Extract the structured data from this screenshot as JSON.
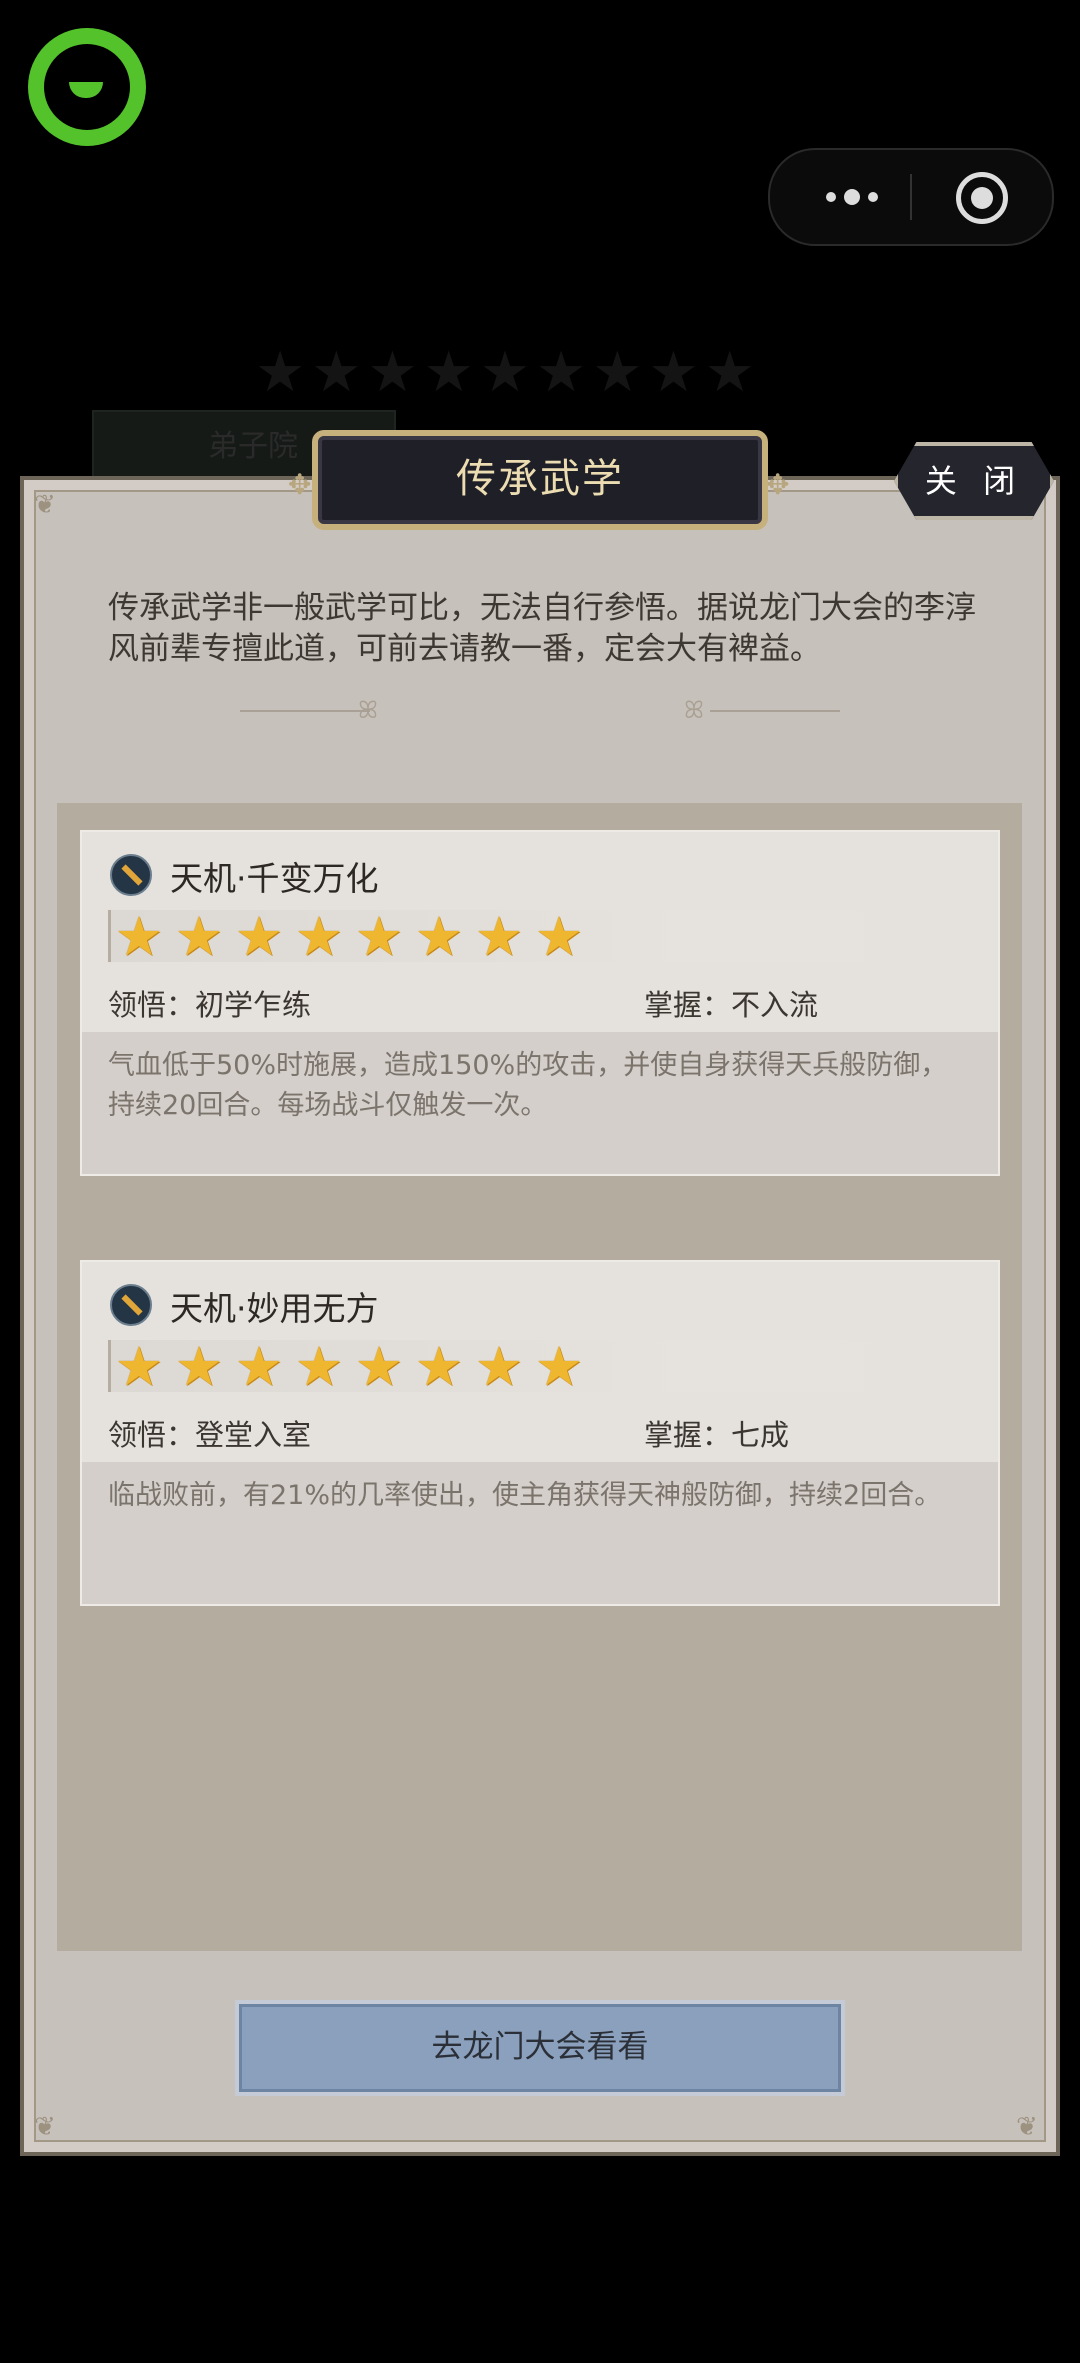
{
  "background": {
    "ghost_tab": "弟子院"
  },
  "dialog": {
    "title": "传承武学",
    "close_label": "关 闭",
    "intro": "传承武学非一般武学可比，无法自行参悟。据说龙门大会的李淳风前辈专擅此道，可前去请教一番，定会大有裨益。",
    "skills": [
      {
        "name": "天机·千变万化",
        "stars": 8,
        "comprehension_label": "领悟：",
        "comprehension_value": "初学乍练",
        "mastery_label": "掌握：",
        "mastery_value": "不入流",
        "description": "气血低于50%时施展，造成150%的攻击，并使自身获得天兵般防御，持续20回合。每场战斗仅触发一次。"
      },
      {
        "name": "天机·妙用无方",
        "stars": 8,
        "comprehension_label": "领悟：",
        "comprehension_value": "登堂入室",
        "mastery_label": "掌握：",
        "mastery_value": "七成",
        "description": "临战败前，有21%的几率使出，使主角获得天神般防御，持续2回合。"
      }
    ],
    "action_button": "去龙门大会看看"
  },
  "colors": {
    "panel": "#c7c1bc",
    "star": "#efb630",
    "button": "#8aa0bd",
    "logo": "#53c22b"
  }
}
